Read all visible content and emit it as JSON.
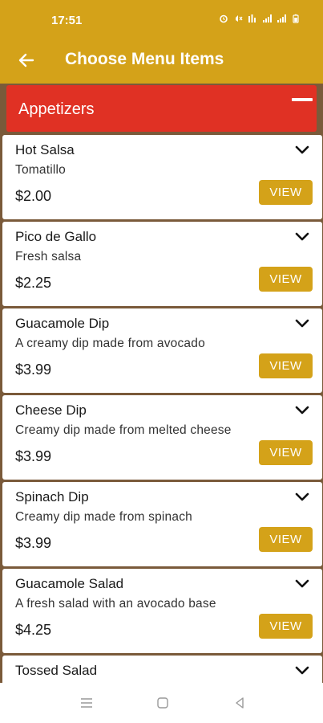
{
  "status_bar": {
    "time": "17:51"
  },
  "header": {
    "title": "Choose Menu Items",
    "back_icon": "arrow-left-icon"
  },
  "section": {
    "title": "Appetizers",
    "toggle_icon": "collapse-minus-icon"
  },
  "items": [
    {
      "name": "Hot Salsa",
      "description": "Tomatillo",
      "price": "$2.00",
      "button": "VIEW"
    },
    {
      "name": "Pico de Gallo",
      "description": "Fresh salsa",
      "price": "$2.25",
      "button": "VIEW"
    },
    {
      "name": "Guacamole Dip",
      "description": "A creamy dip made from avocado",
      "price": "$3.99",
      "button": "VIEW"
    },
    {
      "name": "Cheese Dip",
      "description": "Creamy dip made from melted cheese",
      "price": "$3.99",
      "button": "VIEW"
    },
    {
      "name": "Spinach Dip",
      "description": "Creamy dip made from spinach",
      "price": "$3.99",
      "button": "VIEW"
    },
    {
      "name": "Guacamole Salad",
      "description": "A fresh salad with an avocado base",
      "price": "$4.25",
      "button": "VIEW"
    },
    {
      "name": "Tossed Salad",
      "description": "",
      "price": "",
      "button": ""
    }
  ],
  "colors": {
    "accent": "#d4a219",
    "section_header": "#e03124"
  },
  "nav_bar": {
    "icons": [
      "menu-icon",
      "home-square-icon",
      "back-triangle-icon"
    ]
  }
}
